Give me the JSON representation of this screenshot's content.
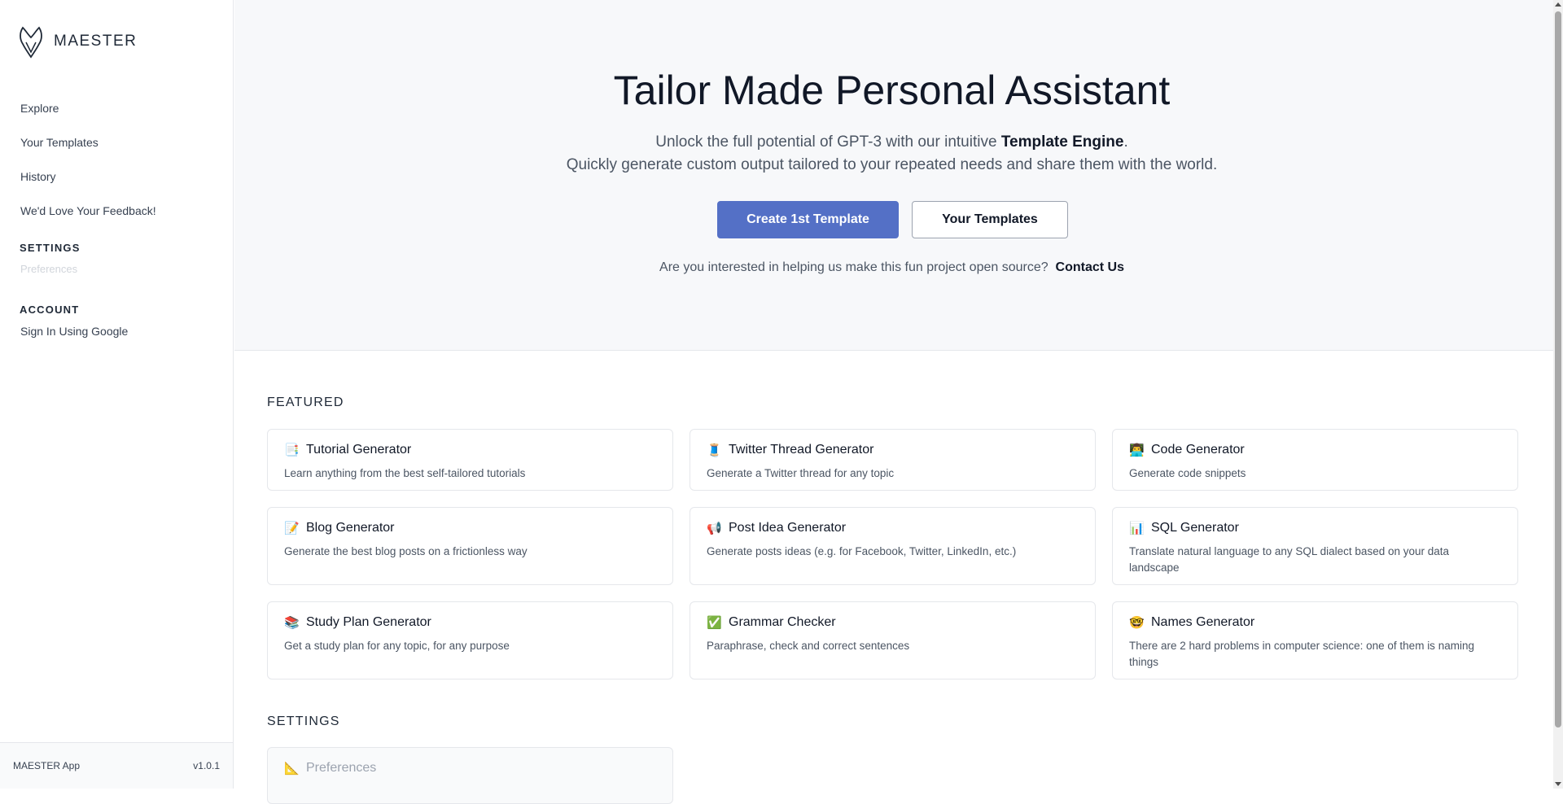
{
  "app": {
    "name": "MAESTER",
    "footer_name": "MAESTER App",
    "version": "v1.0.1"
  },
  "sidebar": {
    "items": [
      {
        "label": "Explore"
      },
      {
        "label": "Your Templates"
      },
      {
        "label": "History"
      },
      {
        "label": "We'd Love Your Feedback!"
      }
    ],
    "settings_heading": "SETTINGS",
    "settings_items": [
      {
        "label": "Preferences"
      }
    ],
    "account_heading": "ACCOUNT",
    "account_items": [
      {
        "label": "Sign In Using Google"
      }
    ]
  },
  "hero": {
    "title": "Tailor Made Personal Assistant",
    "sub_line1_pre": "Unlock the full potential of GPT-3 with our intuitive ",
    "sub_line1_bold": "Template Engine",
    "sub_line1_post": ".",
    "sub_line2": "Quickly generate custom output tailored to your repeated needs and share them with the world.",
    "primary_button": "Create 1st Template",
    "secondary_button": "Your Templates",
    "contact_text": "Are you interested in helping us make this fun project open source?",
    "contact_link": "Contact Us"
  },
  "featured": {
    "heading": "FEATURED",
    "cards": [
      {
        "icon": "📑",
        "title": "Tutorial Generator",
        "desc": "Learn anything from the best self-tailored tutorials"
      },
      {
        "icon": "🧵",
        "title": "Twitter Thread Generator",
        "desc": "Generate a Twitter thread for any topic"
      },
      {
        "icon": "👨‍💻",
        "title": "Code Generator",
        "desc": "Generate code snippets"
      },
      {
        "icon": "📝",
        "title": "Blog Generator",
        "desc": "Generate the best blog posts on a frictionless way"
      },
      {
        "icon": "📢",
        "title": "Post Idea Generator",
        "desc": "Generate posts ideas (e.g. for Facebook, Twitter, LinkedIn, etc.)"
      },
      {
        "icon": "📊",
        "title": "SQL Generator",
        "desc": "Translate natural language to any SQL dialect based on your data landscape"
      },
      {
        "icon": "📚",
        "title": "Study Plan Generator",
        "desc": "Get a study plan for any topic, for any purpose"
      },
      {
        "icon": "✅",
        "title": "Grammar Checker",
        "desc": "Paraphrase, check and correct sentences"
      },
      {
        "icon": "🤓",
        "title": "Names Generator",
        "desc": "There are 2 hard problems in computer science: one of them is naming things"
      }
    ]
  },
  "settings_section": {
    "heading": "SETTINGS",
    "cards": [
      {
        "icon": "📐",
        "title": "Preferences"
      }
    ]
  }
}
